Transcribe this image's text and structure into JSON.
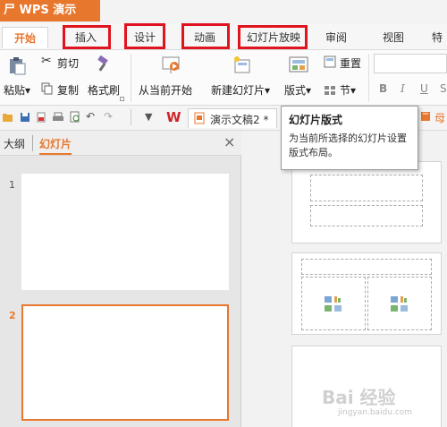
{
  "app": {
    "title": "WPS 演示",
    "logo_glyph": "尸"
  },
  "tabs": [
    {
      "label": "开始",
      "active": true
    },
    {
      "label": "插入"
    },
    {
      "label": "设计"
    },
    {
      "label": "动画"
    },
    {
      "label": "幻灯片放映"
    },
    {
      "label": "审阅"
    },
    {
      "label": "视图"
    },
    {
      "label": "特"
    }
  ],
  "ribbon": {
    "paste": "粘贴",
    "cut": "剪切",
    "copy": "复制",
    "format_painter": "格式刷",
    "from_current": "从当前开始",
    "new_slide": "新建幻灯片",
    "layout": "版式",
    "reset": "重置",
    "section": "节",
    "bold": "B",
    "italic": "I",
    "underline": "U",
    "strike": "S",
    "dropdown_arrow": "▾"
  },
  "document_tab": {
    "label": "演示文稿2 *",
    "icon": "W",
    "right_label": "母"
  },
  "tooltip": {
    "title": "幻灯片版式",
    "body": "为当前所选择的幻灯片设置版式布局。"
  },
  "left_panel": {
    "tab_outline": "大纲",
    "tab_slides": "幻灯片",
    "close": "×",
    "slides": [
      {
        "number": "1"
      },
      {
        "number": "2"
      }
    ]
  },
  "watermark": {
    "main": "Bai 经验",
    "sub": "jingyan.baidu.com"
  },
  "colors": {
    "accent": "#e8772e",
    "highlight": "#e0141e"
  }
}
